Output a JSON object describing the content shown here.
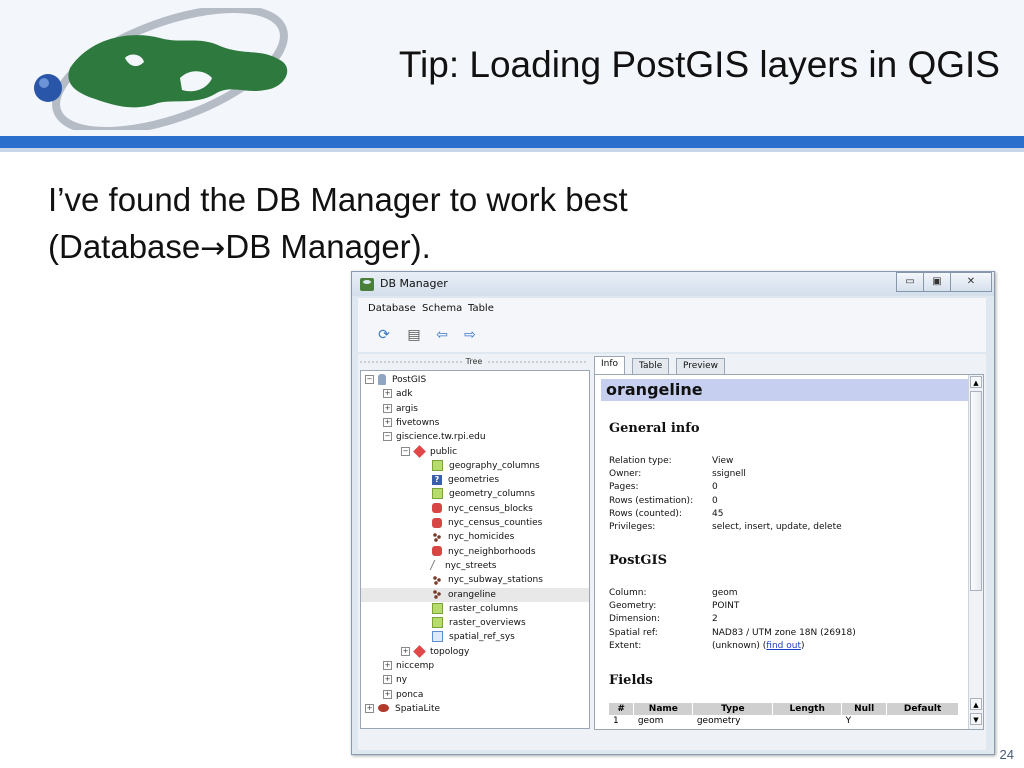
{
  "slide": {
    "title": "Tip: Loading PostGIS layers in QGIS",
    "line1": "I’ve found the DB Manager to work best",
    "line2_pre": "(Database",
    "line2_arrow": "→",
    "line2_post": "DB Manager).",
    "page_number": "24"
  },
  "window": {
    "title": "DB Manager",
    "controls": {
      "minimize": "▭",
      "restore": "▣",
      "close": "✕"
    }
  },
  "menubar": [
    "Database",
    "Schema",
    "Table"
  ],
  "toolbar": [
    "refresh-icon",
    "sql-window-icon",
    "import-layer-icon",
    "export-layer-icon"
  ],
  "tree": {
    "header": "Tree",
    "items": [
      {
        "label": "PostGIS",
        "level": 0,
        "expander": "−",
        "icon": "pg"
      },
      {
        "label": "adk",
        "level": 1,
        "expander": "+",
        "icon": ""
      },
      {
        "label": "argis",
        "level": 1,
        "expander": "+",
        "icon": ""
      },
      {
        "label": "fivetowns",
        "level": 1,
        "expander": "+",
        "icon": ""
      },
      {
        "label": "giscience.tw.rpi.edu",
        "level": 1,
        "expander": "−",
        "icon": ""
      },
      {
        "label": "public",
        "level": 2,
        "expander": "−",
        "icon": "schema"
      },
      {
        "label": "geography_columns",
        "level": 3,
        "expander": "",
        "icon": "view"
      },
      {
        "label": "geometries",
        "level": 3,
        "expander": "",
        "icon": "q"
      },
      {
        "label": "geometry_columns",
        "level": 3,
        "expander": "",
        "icon": "view"
      },
      {
        "label": "nyc_census_blocks",
        "level": 3,
        "expander": "",
        "icon": "poly"
      },
      {
        "label": "nyc_census_counties",
        "level": 3,
        "expander": "",
        "icon": "poly"
      },
      {
        "label": "nyc_homicides",
        "level": 3,
        "expander": "",
        "icon": "pts"
      },
      {
        "label": "nyc_neighborhoods",
        "level": 3,
        "expander": "",
        "icon": "poly"
      },
      {
        "label": "nyc_streets",
        "level": 3,
        "expander": "",
        "icon": "line"
      },
      {
        "label": "nyc_subway_stations",
        "level": 3,
        "expander": "",
        "icon": "pts"
      },
      {
        "label": "orangeline",
        "level": 3,
        "expander": "",
        "icon": "pts",
        "selected": true
      },
      {
        "label": "raster_columns",
        "level": 3,
        "expander": "",
        "icon": "view"
      },
      {
        "label": "raster_overviews",
        "level": 3,
        "expander": "",
        "icon": "view"
      },
      {
        "label": "spatial_ref_sys",
        "level": 3,
        "expander": "",
        "icon": "tbl"
      },
      {
        "label": "topology",
        "level": 2,
        "expander": "+",
        "icon": "schema"
      },
      {
        "label": "niccemp",
        "level": 1,
        "expander": "+",
        "icon": ""
      },
      {
        "label": "ny",
        "level": 1,
        "expander": "+",
        "icon": ""
      },
      {
        "label": "ponca",
        "level": 1,
        "expander": "+",
        "icon": ""
      },
      {
        "label": "SpatiaLite",
        "level": 0,
        "expander": "+",
        "icon": "sl"
      }
    ]
  },
  "tabs": [
    "Info",
    "Table",
    "Preview"
  ],
  "info": {
    "object_name": "orangeline",
    "general_heading": "General info",
    "general": [
      {
        "key": "Relation type:",
        "value": "View"
      },
      {
        "key": "Owner:",
        "value": "ssignell"
      },
      {
        "key": "Pages:",
        "value": "0"
      },
      {
        "key": "Rows (estimation):",
        "value": "0"
      },
      {
        "key": "Rows (counted):",
        "value": "45"
      },
      {
        "key": "Privileges:",
        "value": "select, insert, update, delete"
      }
    ],
    "postgis_heading": "PostGIS",
    "postgis": [
      {
        "key": "Column:",
        "value": "geom"
      },
      {
        "key": "Geometry:",
        "value": "POINT"
      },
      {
        "key": "Dimension:",
        "value": "2"
      },
      {
        "key": "Spatial ref:",
        "value": "NAD83 / UTM zone 18N (26918)"
      },
      {
        "key": "Extent:",
        "value": "(unknown)",
        "link": "find out"
      }
    ],
    "fields_heading": "Fields",
    "fields_columns": [
      "#",
      "Name",
      "Type",
      "Length",
      "Null",
      "Default"
    ],
    "fields_rows": [
      [
        "1",
        "geom",
        "geometry",
        "",
        "Y",
        ""
      ]
    ]
  },
  "colors": {
    "header_bar": "#2a6fcb",
    "title_highlight": "#c6cff0"
  }
}
